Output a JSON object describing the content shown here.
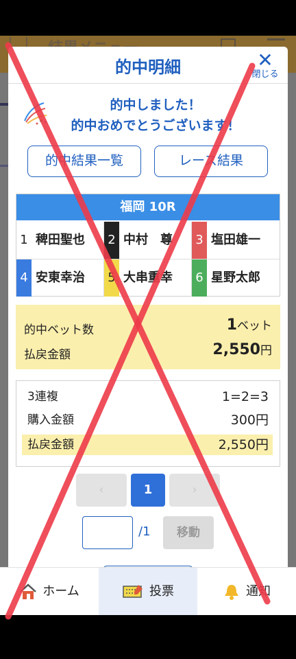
{
  "background": {
    "header_title": "結果メニュー"
  },
  "modal": {
    "title": "的中明細",
    "close_label": "閉じる",
    "congrats_line1": "的中しました！",
    "congrats_line2": "的中おめでとうございます！",
    "results_list_button": "的中結果一覧",
    "race_result_button": "レース結果"
  },
  "race": {
    "header": "福岡 10R",
    "entries": [
      {
        "num": "1",
        "name": "稗田聖也",
        "bg": "#ffffff",
        "fg": "#222222"
      },
      {
        "num": "2",
        "name": "中村　尊",
        "bg": "#222222",
        "fg": "#ffffff"
      },
      {
        "num": "3",
        "name": "塩田雄一",
        "bg": "#e05a5a",
        "fg": "#ffffff"
      },
      {
        "num": "4",
        "name": "安東幸治",
        "bg": "#3a7be0",
        "fg": "#ffffff"
      },
      {
        "num": "5",
        "name": "大串重幸",
        "bg": "#f2d94a",
        "fg": "#222222"
      },
      {
        "num": "6",
        "name": "星野太郎",
        "bg": "#4cae5c",
        "fg": "#ffffff"
      }
    ]
  },
  "summary": {
    "hit_bets_label": "的中ベット数",
    "hit_bets_value": "1",
    "hit_bets_unit": "ベット",
    "payout_label": "払戻金額",
    "payout_value": "2,550",
    "payout_unit": "円"
  },
  "detail": {
    "bet_type": "3連複",
    "combination": "1=2=3",
    "purchase_label": "購入金額",
    "purchase_value": "300円",
    "payout_label": "払戻金額",
    "payout_value": "2,550円"
  },
  "pagination": {
    "prev": "‹",
    "current": "1",
    "next": "›",
    "input_value": "",
    "total": "/1",
    "move_label": "移動"
  },
  "bottom_nav": {
    "home_label": "ホーム",
    "vote_label": "投票",
    "notify_label": "通知"
  },
  "colors": {
    "accent": "#1f5fbf",
    "race_header": "#3a8ee6",
    "highlight": "#fbefad",
    "overlay_x": "#ee3b4a"
  }
}
